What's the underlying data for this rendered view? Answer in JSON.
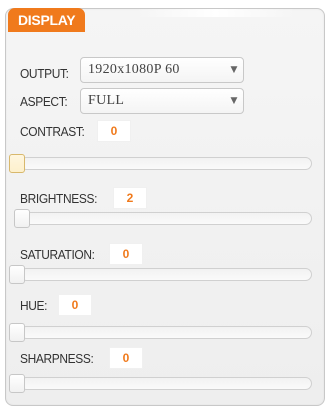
{
  "panel": {
    "tab_label": "DISPLAY"
  },
  "output": {
    "label": "OUTPUT:",
    "value": "1920x1080P 60",
    "arrow": "▼"
  },
  "aspect": {
    "label": "ASPECT:",
    "value": "FULL",
    "arrow": "▼"
  },
  "sliders": {
    "contrast": {
      "label": "CONTRAST:",
      "value": "0",
      "position": 0
    },
    "brightness": {
      "label": "BRIGHTNESS:",
      "value": "2",
      "position": 0.02
    },
    "saturation": {
      "label": "SATURATION:",
      "value": "0",
      "position": 0
    },
    "hue": {
      "label": "HUE:",
      "value": "0",
      "position": 0
    },
    "sharpness": {
      "label": "SHARPNESS:",
      "value": "0",
      "position": 0
    }
  },
  "colors": {
    "accent": "#f07a1c",
    "active_thumb": "#fdf0cc"
  }
}
